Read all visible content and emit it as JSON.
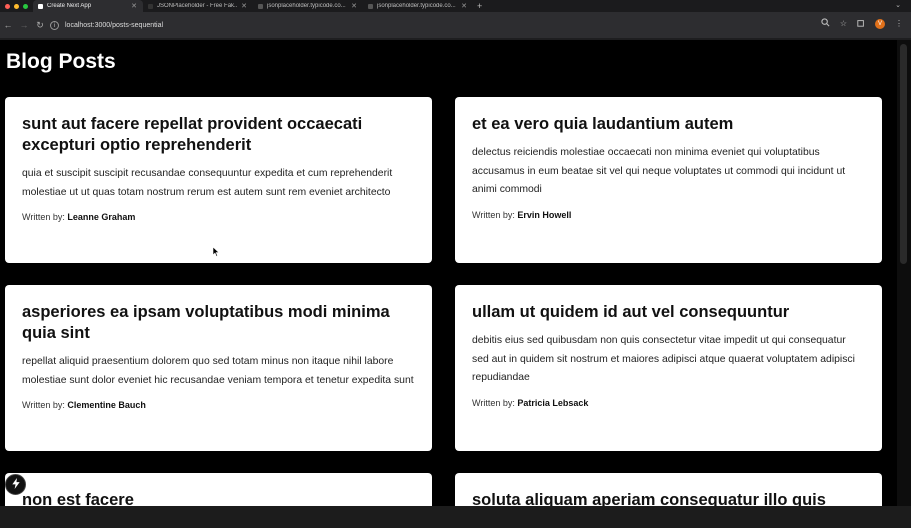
{
  "browser": {
    "tabs": [
      {
        "label": "Create Next App",
        "active": true
      },
      {
        "label": "JSONPlaceholder - Free Fak...",
        "active": false
      },
      {
        "label": "jsonplaceholder.typicode.co...",
        "active": false
      },
      {
        "label": "jsonplaceholder.typicode.co...",
        "active": false
      }
    ],
    "url": "localhost:3000/posts-sequential",
    "profile_initial": "V"
  },
  "page": {
    "title": "Blog Posts",
    "author_prefix": "Written by:"
  },
  "posts": [
    {
      "title": "sunt aut facere repellat provident occaecati excepturi optio reprehenderit",
      "body": "quia et suscipit suscipit recusandae consequuntur expedita et cum reprehenderit molestiae ut ut quas totam nostrum rerum est autem sunt rem eveniet architecto",
      "author": "Leanne Graham"
    },
    {
      "title": "et ea vero quia laudantium autem",
      "body": "delectus reiciendis molestiae occaecati non minima eveniet qui voluptatibus accusamus in eum beatae sit vel qui neque voluptates ut commodi qui incidunt ut animi commodi",
      "author": "Ervin Howell"
    },
    {
      "title": "asperiores ea ipsam voluptatibus modi minima quia sint",
      "body": "repellat aliquid praesentium dolorem quo sed totam minus non itaque nihil labore molestiae sunt dolor eveniet hic recusandae veniam tempora et tenetur expedita sunt",
      "author": "Clementine Bauch"
    },
    {
      "title": "ullam ut quidem id aut vel consequuntur",
      "body": "debitis eius sed quibusdam non quis consectetur vitae impedit ut qui consequatur sed aut in quidem sit nostrum et maiores adipisci atque quaerat voluptatem adipisci repudiandae",
      "author": "Patricia Lebsack"
    },
    {
      "title": "non est facere",
      "body": "",
      "author": ""
    },
    {
      "title": "soluta aliquam aperiam consequatur illo quis",
      "body": "",
      "author": ""
    }
  ],
  "colors": {
    "page_bg": "#000000",
    "card_bg": "#ffffff",
    "traffic_lights": [
      "#ff5f57",
      "#febc2e",
      "#28c840"
    ]
  }
}
